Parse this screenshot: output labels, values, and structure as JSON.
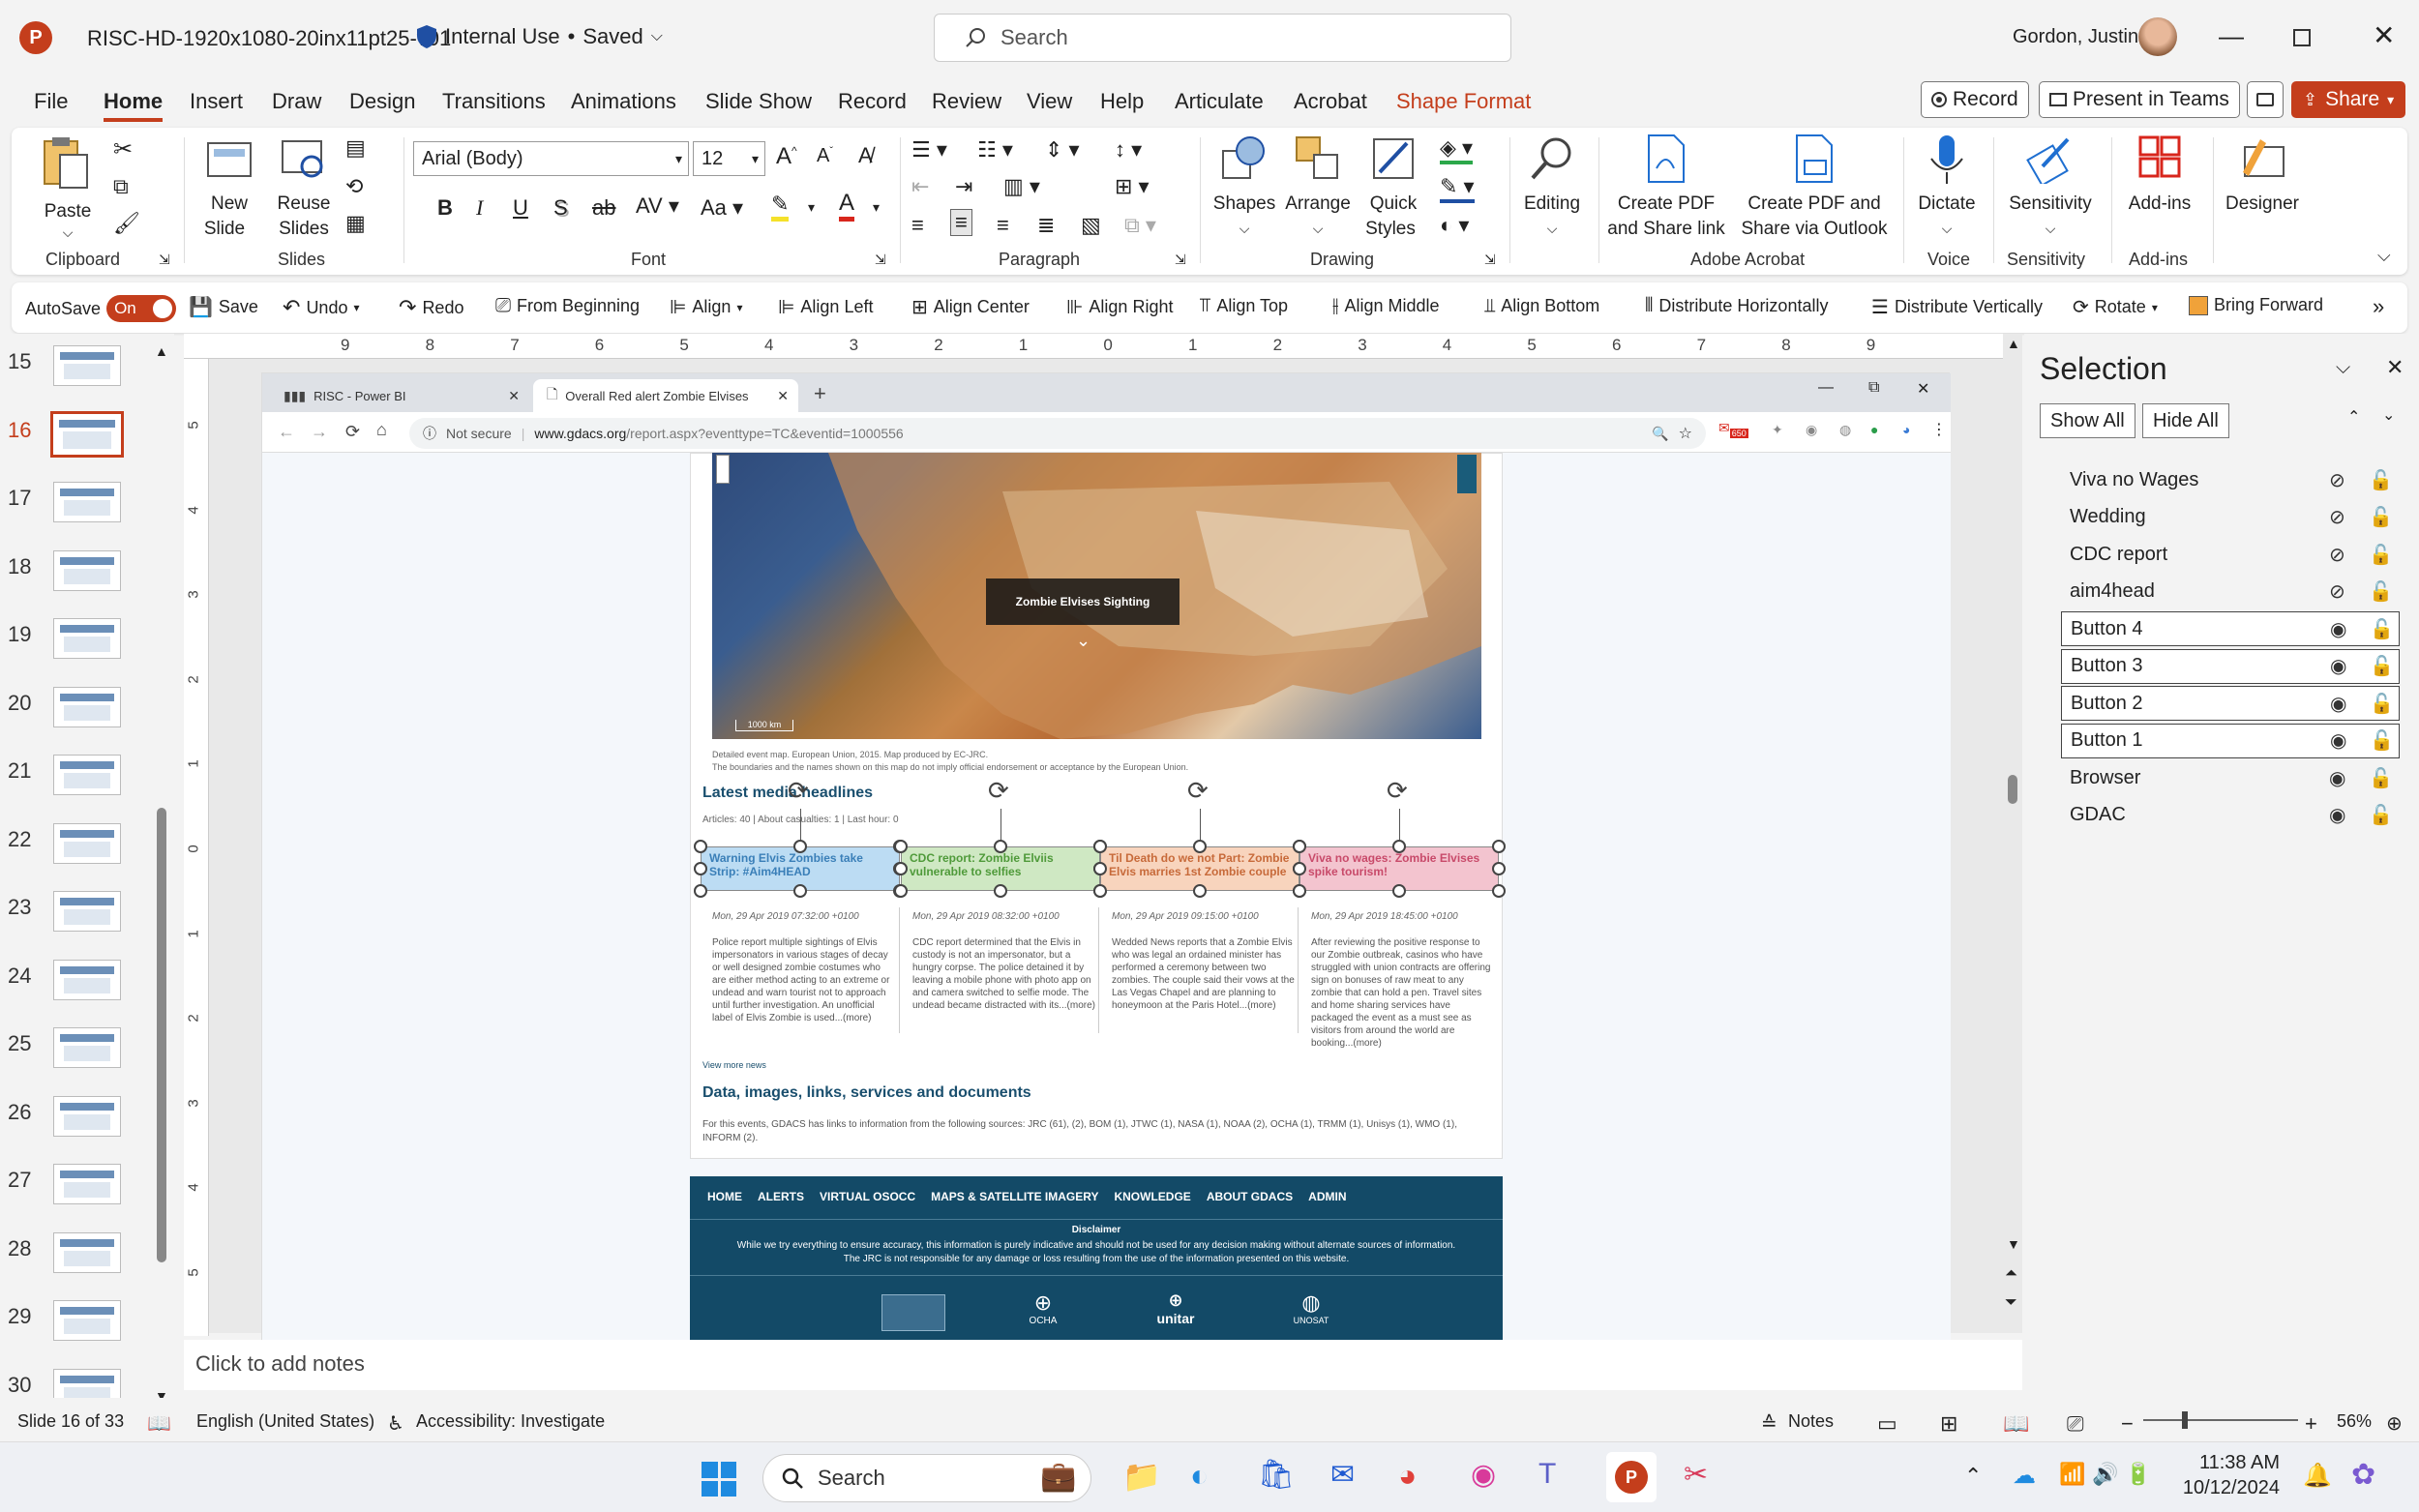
{
  "titlebar": {
    "app_icon": "P",
    "filename": "RISC-HD-1920x1080-20inx11pt25-v01",
    "sensitivity": "Internal Use",
    "save_state": "Saved",
    "search_placeholder": "Search",
    "user": "Gordon, Justin"
  },
  "menu": {
    "items": [
      "File",
      "Home",
      "Insert",
      "Draw",
      "Design",
      "Transitions",
      "Animations",
      "Slide Show",
      "Record",
      "Review",
      "View",
      "Help",
      "Articulate",
      "Acrobat",
      "Shape Format"
    ],
    "active": "Home",
    "contextual": "Shape Format",
    "record_btn": "Record",
    "present_btn": "Present in Teams",
    "share_btn": "Share"
  },
  "ribbon": {
    "clipboard": {
      "paste": "Paste",
      "label": "Clipboard"
    },
    "slides": {
      "new_slide": "New",
      "new_slide2": "Slide",
      "reuse": "Reuse",
      "reuse2": "Slides",
      "label": "Slides"
    },
    "font": {
      "family": "Arial (Body)",
      "size": "12",
      "label": "Font"
    },
    "paragraph": {
      "label": "Paragraph"
    },
    "drawing": {
      "shapes": "Shapes",
      "arrange": "Arrange",
      "quick": "Quick",
      "quick2": "Styles",
      "label": "Drawing"
    },
    "editing": {
      "label": "Editing"
    },
    "acrobat": {
      "create1": "Create PDF",
      "create2": "and Share link",
      "share1": "Create PDF and",
      "share2": "Share via Outlook",
      "label": "Adobe Acrobat"
    },
    "voice": {
      "dictate": "Dictate",
      "label": "Voice"
    },
    "sensitivity": {
      "btn": "Sensitivity",
      "label": "Sensitivity"
    },
    "addins": {
      "btn": "Add-ins",
      "label": "Add-ins"
    },
    "designer": {
      "btn": "Designer"
    }
  },
  "qat": {
    "autosave": "AutoSave",
    "autosave_state": "On",
    "save": "Save",
    "undo": "Undo",
    "redo": "Redo",
    "from_beginning": "From Beginning",
    "align": "Align",
    "align_left": "Align Left",
    "align_center": "Align Center",
    "align_right": "Align Right",
    "align_top": "Align Top",
    "align_middle": "Align Middle",
    "align_bottom": "Align Bottom",
    "dist_h": "Distribute Horizontally",
    "dist_v": "Distribute Vertically",
    "rotate": "Rotate",
    "bring_forward": "Bring Forward"
  },
  "thumbnails": {
    "numbers": [
      "15",
      "16",
      "17",
      "18",
      "19",
      "20",
      "21",
      "22",
      "23",
      "24",
      "25",
      "26",
      "27",
      "28",
      "29",
      "30"
    ],
    "active": "16"
  },
  "ruler": {
    "h": [
      "9",
      "8",
      "7",
      "6",
      "5",
      "4",
      "3",
      "2",
      "1",
      "0",
      "1",
      "2",
      "3",
      "4",
      "5",
      "6",
      "7",
      "8",
      "9"
    ],
    "v": [
      "5",
      "4",
      "3",
      "2",
      "1",
      "0",
      "1",
      "2",
      "3",
      "4",
      "5"
    ]
  },
  "browser": {
    "tab1": "RISC - Power BI",
    "tab2": "Overall Red alert Zombie Elvises",
    "not_secure": "Not secure",
    "url_host": "www.gdacs.org",
    "url_path": "/report.aspx?eventtype=TC&eventid=1000556",
    "ext_badge": "650"
  },
  "webpage": {
    "map_tooltip": "Zombie Elvises Sighting",
    "map_scale": "1000 km",
    "map_caption1": "Detailed event map. European Union, 2015. Map produced by EC-JRC.",
    "map_caption2": "The boundaries and the names shown on this map do not imply official endorsement or acceptance by the European Union.",
    "headline_title": "Latest media headlines",
    "articles_meta": "Articles: 40 | About casualties: 1 | Last hour: 0",
    "cards": [
      {
        "title": "Warning Elvis Zombies take Strip: #Aim4HEAD",
        "date": "Mon, 29 Apr 2019 07:32:00 +0100",
        "body": "Police report multiple sightings of Elvis impersonators in various stages of decay or well designed zombie costumes who are either method acting to an extreme or undead and warn tourist not to approach until further investigation. An unofficial label of Elvis Zombie is used...(more)"
      },
      {
        "title": "CDC report: Zombie Elviis vulnerable to selfies",
        "date": "Mon, 29 Apr 2019 08:32:00 +0100",
        "body": "CDC report determined that the Elvis in custody is not an impersonator, but a hungry corpse. The police detained it by leaving a mobile phone with photo app on and camera switched to selfie mode. The undead became distracted with its...(more)"
      },
      {
        "title": "Til Death do we not Part: Zombie Elvis marries 1st Zombie couple",
        "date": "Mon, 29 Apr 2019 09:15:00 +0100",
        "body": "Wedded News reports that a Zombie Elvis who was legal an ordained minister has performed a ceremony between two zombies. The couple said their vows at the Las Vegas Chapel and are planning to honeymoon at the Paris Hotel...(more)"
      },
      {
        "title": "Viva no wages: Zombie Elvises spike tourism!",
        "date": "Mon, 29 Apr 2019 18:45:00 +0100",
        "body": "After reviewing the positive response to our Zombie outbreak, casinos who have struggled with union contracts are offering sign on bonuses of raw meat to any zombie that can hold a pen. Travel sites and home sharing services have packaged the event as a must see as visitors from around the world are booking...(more)"
      }
    ],
    "view_more": "View more news",
    "data_title": "Data, images, links, services and documents",
    "data_body": "For this events, GDACS has links to information from the following sources: JRC (61), (2), BOM (1), JTWC (1), NASA (1), NOAA (2), OCHA (1), TRMM (1), Unisys (1), WMO (1), INFORM (2).",
    "footer_nav": [
      "HOME",
      "ALERTS",
      "VIRTUAL OSOCC",
      "MAPS & SATELLITE IMAGERY",
      "KNOWLEDGE",
      "ABOUT GDACS",
      "ADMIN"
    ],
    "disclaimer_title": "Disclaimer",
    "disclaimer1": "While we try everything to ensure accuracy, this information is purely indicative and should not be used for any decision making without alternate sources of information.",
    "disclaimer2": "The JRC is not responsible for any damage or loss resulting from the use of the information presented on this website.",
    "logos": [
      "OCHA",
      "unitar",
      "UNOSAT"
    ]
  },
  "notes": {
    "placeholder": "Click to add notes"
  },
  "selection": {
    "title": "Selection",
    "show_all": "Show All",
    "hide_all": "Hide All",
    "items": [
      {
        "name": "Viva no Wages",
        "visible": false,
        "boxed": false
      },
      {
        "name": "Wedding",
        "visible": false,
        "boxed": false
      },
      {
        "name": "CDC report",
        "visible": false,
        "boxed": false
      },
      {
        "name": "aim4head",
        "visible": false,
        "boxed": false
      },
      {
        "name": "Button 4",
        "visible": true,
        "boxed": true
      },
      {
        "name": "Button 3",
        "visible": true,
        "boxed": true
      },
      {
        "name": "Button 2",
        "visible": true,
        "boxed": true
      },
      {
        "name": "Button 1",
        "visible": true,
        "boxed": true
      },
      {
        "name": "Browser",
        "visible": true,
        "boxed": false
      },
      {
        "name": "GDAC",
        "visible": true,
        "boxed": false
      }
    ]
  },
  "status": {
    "slide": "Slide 16 of 33",
    "language": "English (United States)",
    "accessibility": "Accessibility: Investigate",
    "notes": "Notes",
    "zoom": "56%"
  },
  "taskbar": {
    "search": "Search",
    "time": "11:38 AM",
    "date": "10/12/2024"
  },
  "colors": {
    "accent": "#c43e1c",
    "share_bg": "#c43e1c",
    "gdacs_blue": "#1a5c7a",
    "card1": "#bcdcf3",
    "card2": "#cfe8c3",
    "card3": "#f8d4bd",
    "card4": "#f3c4cf"
  }
}
